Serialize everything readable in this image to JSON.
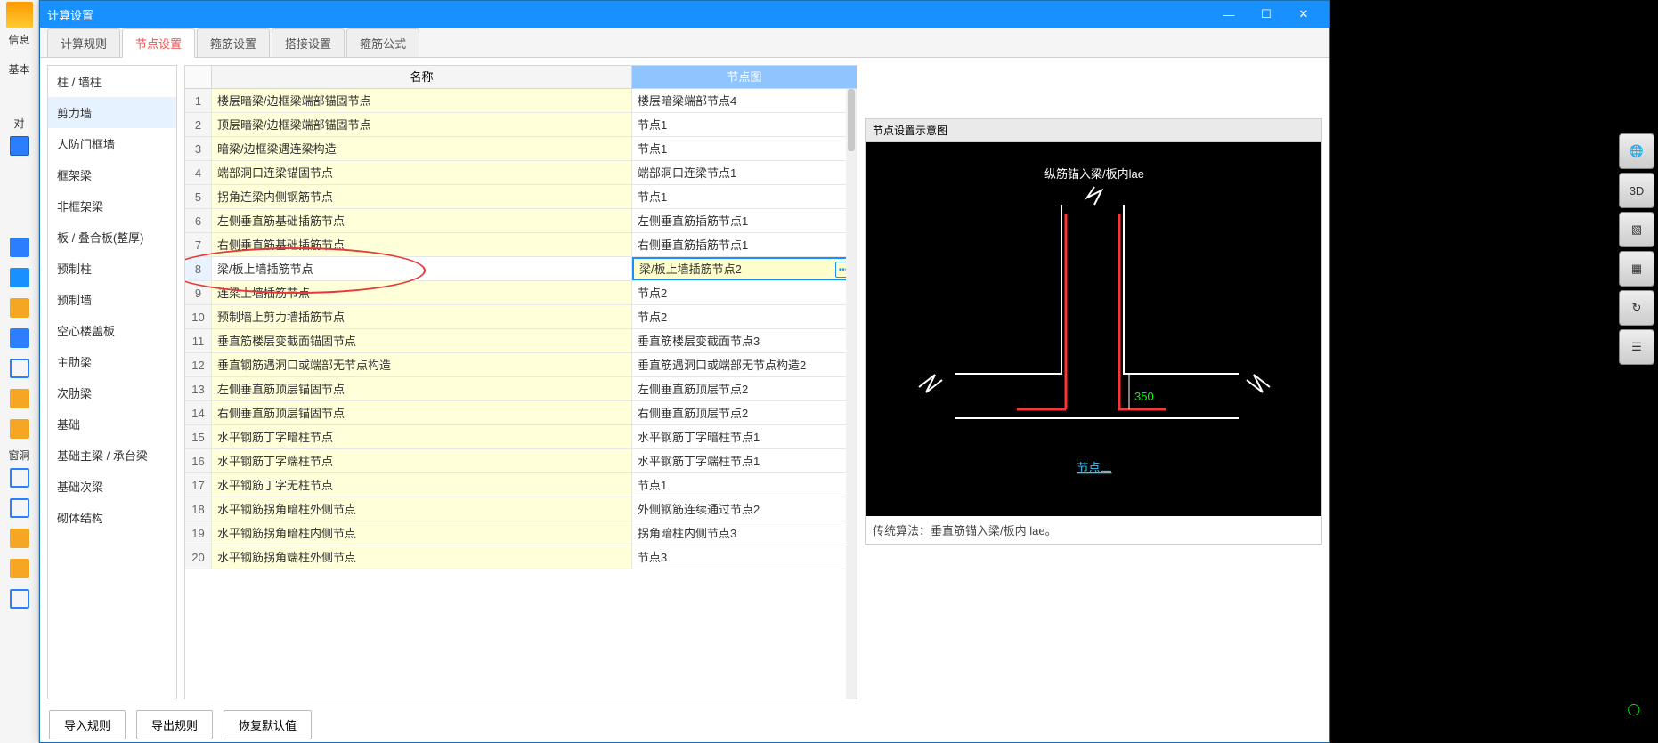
{
  "window": {
    "title": "计算设置"
  },
  "tabs": [
    "计算规则",
    "节点设置",
    "箍筋设置",
    "搭接设置",
    "箍筋公式"
  ],
  "active_tab_index": 1,
  "categories": [
    "柱 / 墙柱",
    "剪力墙",
    "人防门框墙",
    "框架梁",
    "非框架梁",
    "板 / 叠合板(整厚)",
    "预制柱",
    "预制墙",
    "空心楼盖板",
    "主肋梁",
    "次肋梁",
    "基础",
    "基础主梁 / 承台梁",
    "基础次梁",
    "砌体结构"
  ],
  "selected_category_index": 1,
  "table": {
    "columns": [
      "名称",
      "节点图"
    ],
    "rows": [
      {
        "n": 1,
        "name": "楼层暗梁/边框梁端部锚固节点",
        "node": "楼层暗梁端部节点4"
      },
      {
        "n": 2,
        "name": "顶层暗梁/边框梁端部锚固节点",
        "node": "节点1"
      },
      {
        "n": 3,
        "name": "暗梁/边框梁遇连梁构造",
        "node": "节点1"
      },
      {
        "n": 4,
        "name": "端部洞口连梁锚固节点",
        "node": "端部洞口连梁节点1"
      },
      {
        "n": 5,
        "name": "拐角连梁内侧钢筋节点",
        "node": "节点1"
      },
      {
        "n": 6,
        "name": "左侧垂直筋基础插筋节点",
        "node": "左侧垂直筋插筋节点1"
      },
      {
        "n": 7,
        "name": "右侧垂直筋基础插筋节点",
        "node": "右侧垂直筋插筋节点1"
      },
      {
        "n": 8,
        "name": "梁/板上墙插筋节点",
        "node": "梁/板上墙插筋节点2"
      },
      {
        "n": 9,
        "name": "连梁上墙插筋节点",
        "node": "节点2"
      },
      {
        "n": 10,
        "name": "预制墙上剪力墙插筋节点",
        "node": "节点2"
      },
      {
        "n": 11,
        "name": "垂直筋楼层变截面锚固节点",
        "node": "垂直筋楼层变截面节点3"
      },
      {
        "n": 12,
        "name": "垂直钢筋遇洞口或端部无节点构造",
        "node": "垂直筋遇洞口或端部无节点构造2"
      },
      {
        "n": 13,
        "name": "左侧垂直筋顶层锚固节点",
        "node": "左侧垂直筋顶层节点2"
      },
      {
        "n": 14,
        "name": "右侧垂直筋顶层锚固节点",
        "node": "右侧垂直筋顶层节点2"
      },
      {
        "n": 15,
        "name": "水平钢筋丁字暗柱节点",
        "node": "水平钢筋丁字暗柱节点1"
      },
      {
        "n": 16,
        "name": "水平钢筋丁字端柱节点",
        "node": "水平钢筋丁字端柱节点1"
      },
      {
        "n": 17,
        "name": "水平钢筋丁字无柱节点",
        "node": "节点1"
      },
      {
        "n": 18,
        "name": "水平钢筋拐角暗柱外侧节点",
        "node": "外侧钢筋连续通过节点2"
      },
      {
        "n": 19,
        "name": "水平钢筋拐角暗柱内侧节点",
        "node": "拐角暗柱内侧节点3"
      },
      {
        "n": 20,
        "name": "水平钢筋拐角端柱外侧节点",
        "node": "节点3"
      }
    ],
    "selected_row": 8
  },
  "preview": {
    "header": "节点设置示意图",
    "diagram_title": "纵筋锚入梁/板内lae",
    "diagram_value": "350",
    "diagram_label": "节点二",
    "note": "传统算法：垂直筋锚入梁/板内 lae。"
  },
  "footer_buttons": [
    "导入规则",
    "导出规则",
    "恢复默认值"
  ],
  "left_strip_labels": [
    "信息",
    "基本",
    "对",
    "窗洞"
  ],
  "right_tools_hint": [
    "3D"
  ]
}
